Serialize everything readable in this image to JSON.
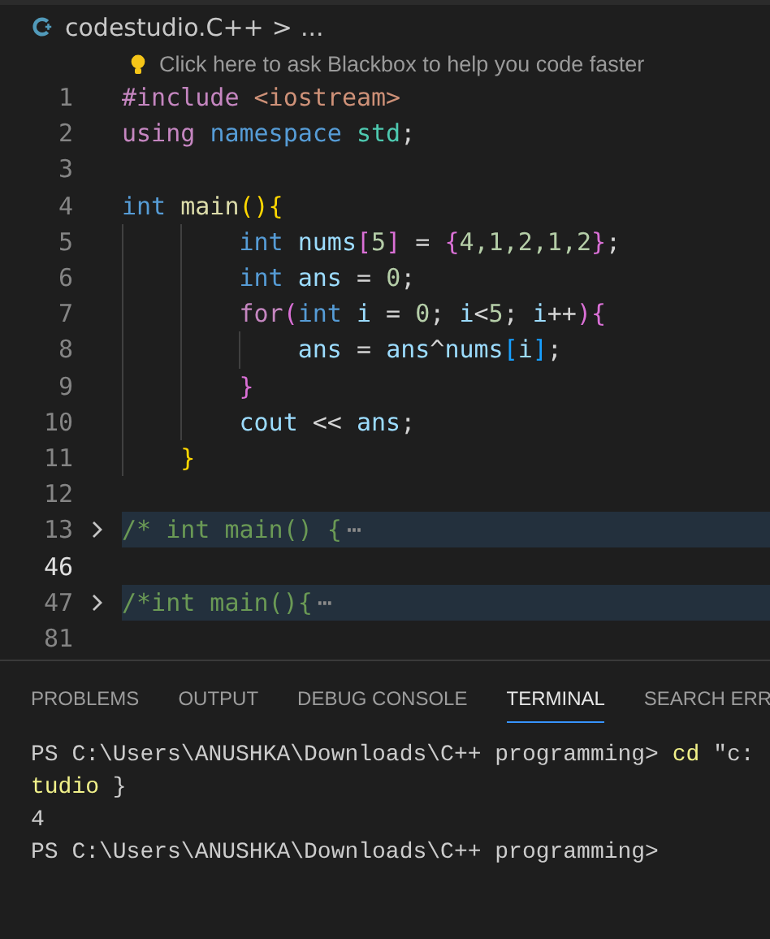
{
  "breadcrumb": {
    "file": "codestudio.C++",
    "separator": ">",
    "more": "..."
  },
  "hint": "Click here to ask Blackbox to help you code faster",
  "editor": {
    "lines": [
      {
        "number": "1",
        "kind": "code",
        "active": false,
        "tokens": [
          {
            "t": "#include ",
            "color": "#c586c0"
          },
          {
            "t": "<iostream>",
            "color": "#ce9178"
          }
        ]
      },
      {
        "number": "2",
        "kind": "code",
        "active": false,
        "tokens": [
          {
            "t": "using ",
            "color": "#c586c0"
          },
          {
            "t": "namespace ",
            "color": "#569cd6"
          },
          {
            "t": "std",
            "color": "#4ec9b0"
          },
          {
            "t": ";",
            "color": "#d4d4d4"
          }
        ]
      },
      {
        "number": "3",
        "kind": "code",
        "active": false
      },
      {
        "number": "4",
        "kind": "code",
        "active": false,
        "tokens": [
          {
            "t": "int ",
            "color": "#569cd6"
          },
          {
            "t": "main",
            "color": "#dcdcaa"
          },
          {
            "t": "(){",
            "color": "#ffd700"
          }
        ]
      },
      {
        "number": "5",
        "kind": "code",
        "active": false,
        "tokens": [
          {
            "t": "        int ",
            "color": "#569cd6"
          },
          {
            "t": "nums",
            "color": "#9cdcfe"
          },
          {
            "t": "[",
            "color": "#da70d6"
          },
          {
            "t": "5",
            "color": "#b5cea8"
          },
          {
            "t": "]",
            "color": "#da70d6"
          },
          {
            "t": " = ",
            "color": "#d4d4d4"
          },
          {
            "t": "{",
            "color": "#da70d6"
          },
          {
            "t": "4,1,2,1,2",
            "color": "#b5cea8"
          },
          {
            "t": "}",
            "color": "#da70d6"
          },
          {
            "t": ";",
            "color": "#d4d4d4"
          }
        ]
      },
      {
        "number": "6",
        "kind": "code",
        "active": false,
        "tokens": [
          {
            "t": "        int ",
            "color": "#569cd6"
          },
          {
            "t": "ans",
            "color": "#9cdcfe"
          },
          {
            "t": " = ",
            "color": "#d4d4d4"
          },
          {
            "t": "0",
            "color": "#b5cea8"
          },
          {
            "t": ";",
            "color": "#d4d4d4"
          }
        ]
      },
      {
        "number": "7",
        "kind": "code",
        "active": false,
        "tokens": [
          {
            "t": "        for",
            "color": "#c586c0"
          },
          {
            "t": "(",
            "color": "#da70d6"
          },
          {
            "t": "int ",
            "color": "#569cd6"
          },
          {
            "t": "i",
            "color": "#9cdcfe"
          },
          {
            "t": " = ",
            "color": "#d4d4d4"
          },
          {
            "t": "0",
            "color": "#b5cea8"
          },
          {
            "t": "; ",
            "color": "#d4d4d4"
          },
          {
            "t": "i",
            "color": "#9cdcfe"
          },
          {
            "t": "<",
            "color": "#d4d4d4"
          },
          {
            "t": "5",
            "color": "#b5cea8"
          },
          {
            "t": "; ",
            "color": "#d4d4d4"
          },
          {
            "t": "i",
            "color": "#9cdcfe"
          },
          {
            "t": "++",
            "color": "#d4d4d4"
          },
          {
            "t": "){",
            "color": "#da70d6"
          }
        ]
      },
      {
        "number": "8",
        "kind": "code",
        "active": false,
        "tokens": [
          {
            "t": "            ans",
            "color": "#9cdcfe"
          },
          {
            "t": " = ",
            "color": "#d4d4d4"
          },
          {
            "t": "ans",
            "color": "#9cdcfe"
          },
          {
            "t": "^",
            "color": "#d4d4d4"
          },
          {
            "t": "nums",
            "color": "#9cdcfe"
          },
          {
            "t": "[",
            "color": "#179fff"
          },
          {
            "t": "i",
            "color": "#9cdcfe"
          },
          {
            "t": "]",
            "color": "#179fff"
          },
          {
            "t": ";",
            "color": "#d4d4d4"
          }
        ]
      },
      {
        "number": "9",
        "kind": "code",
        "active": false,
        "tokens": [
          {
            "t": "        }",
            "color": "#da70d6"
          }
        ]
      },
      {
        "number": "10",
        "kind": "code",
        "active": false,
        "tokens": [
          {
            "t": "        cout",
            "color": "#9cdcfe"
          },
          {
            "t": " << ",
            "color": "#d4d4d4"
          },
          {
            "t": "ans",
            "color": "#9cdcfe"
          },
          {
            "t": ";",
            "color": "#d4d4d4"
          }
        ]
      },
      {
        "number": "11",
        "kind": "code",
        "active": false,
        "tokens": [
          {
            "t": "    }",
            "color": "#ffd700"
          }
        ]
      },
      {
        "number": "12",
        "kind": "code",
        "active": false
      },
      {
        "number": "13",
        "kind": "folded",
        "active": false,
        "tokens": [
          {
            "t": "/* int main() {",
            "color": "#6a9955"
          }
        ],
        "ellipsis": "⋯"
      },
      {
        "number": "46",
        "kind": "code",
        "active": true
      },
      {
        "number": "47",
        "kind": "folded",
        "active": false,
        "tokens": [
          {
            "t": "/*int main(){",
            "color": "#6a9955"
          }
        ],
        "ellipsis": "⋯"
      },
      {
        "number": "81",
        "kind": "code",
        "active": false
      }
    ]
  },
  "panel": {
    "tabs": [
      {
        "label": "PROBLEMS",
        "selected": false
      },
      {
        "label": "OUTPUT",
        "selected": false
      },
      {
        "label": "DEBUG CONSOLE",
        "selected": false
      },
      {
        "label": "TERMINAL",
        "selected": true
      },
      {
        "label": "SEARCH ERR",
        "selected": false
      }
    ],
    "terminal": [
      [
        {
          "t": "PS C:\\Users\\ANUSHKA\\Downloads\\C++ programming> ",
          "color": "#cccccc"
        },
        {
          "t": "cd",
          "color": "#f1f18a"
        },
        {
          "t": " \"c:",
          "color": "#cccccc"
        }
      ],
      [
        {
          "t": "tudio",
          "color": "#f1f18a"
        },
        {
          "t": " }",
          "color": "#cccccc"
        }
      ],
      [
        {
          "t": "4",
          "color": "#cccccc"
        }
      ],
      [
        {
          "t": "PS C:\\Users\\ANUSHKA\\Downloads\\C++ programming>",
          "color": "#cccccc"
        }
      ]
    ]
  }
}
